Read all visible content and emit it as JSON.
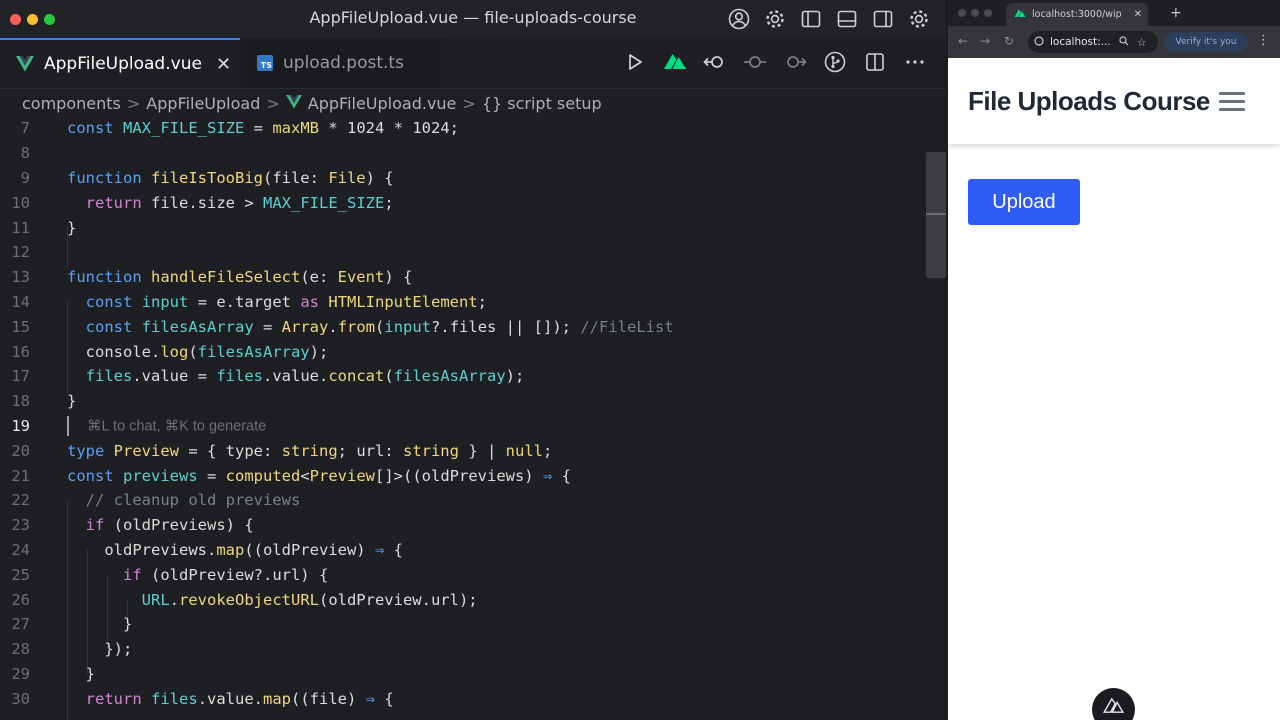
{
  "editor": {
    "window_title": "AppFileUpload.vue — file-uploads-course",
    "traffic_colors": [
      "#ff5f57",
      "#febc2e",
      "#28c840"
    ],
    "tabs": [
      {
        "label": "AppFileUpload.vue",
        "icon": "vue-icon",
        "active": true,
        "close": "✕"
      },
      {
        "label": "upload.post.ts",
        "icon": "typescript-icon",
        "active": false
      }
    ],
    "ts_badge": "TS",
    "breadcrumb": [
      "components",
      "AppFileUpload",
      "AppFileUpload.vue",
      "{} script setup"
    ],
    "breadcrumb_sep": ">",
    "hint_text": "⌘L to chat, ⌘K to generate",
    "line_numbers": [
      "7",
      "8",
      "9",
      "10",
      "11",
      "12",
      "13",
      "14",
      "15",
      "16",
      "17",
      "18",
      "19",
      "20",
      "21",
      "22",
      "23",
      "24",
      "25",
      "26",
      "27",
      "28",
      "29",
      "30"
    ]
  },
  "browser": {
    "tab_title": "localhost:3000/wip",
    "tab_close": "✕",
    "new_tab": "+",
    "url": "localhost:...",
    "verify_label": "Verify it's you",
    "menu": "⋮",
    "site_title": "File Uploads Course",
    "upload_label": "Upload"
  },
  "colors": {
    "accent_blue": "#2f5cf5",
    "vue_green": "#41b883",
    "tab_indicator": "#3b82f6"
  }
}
